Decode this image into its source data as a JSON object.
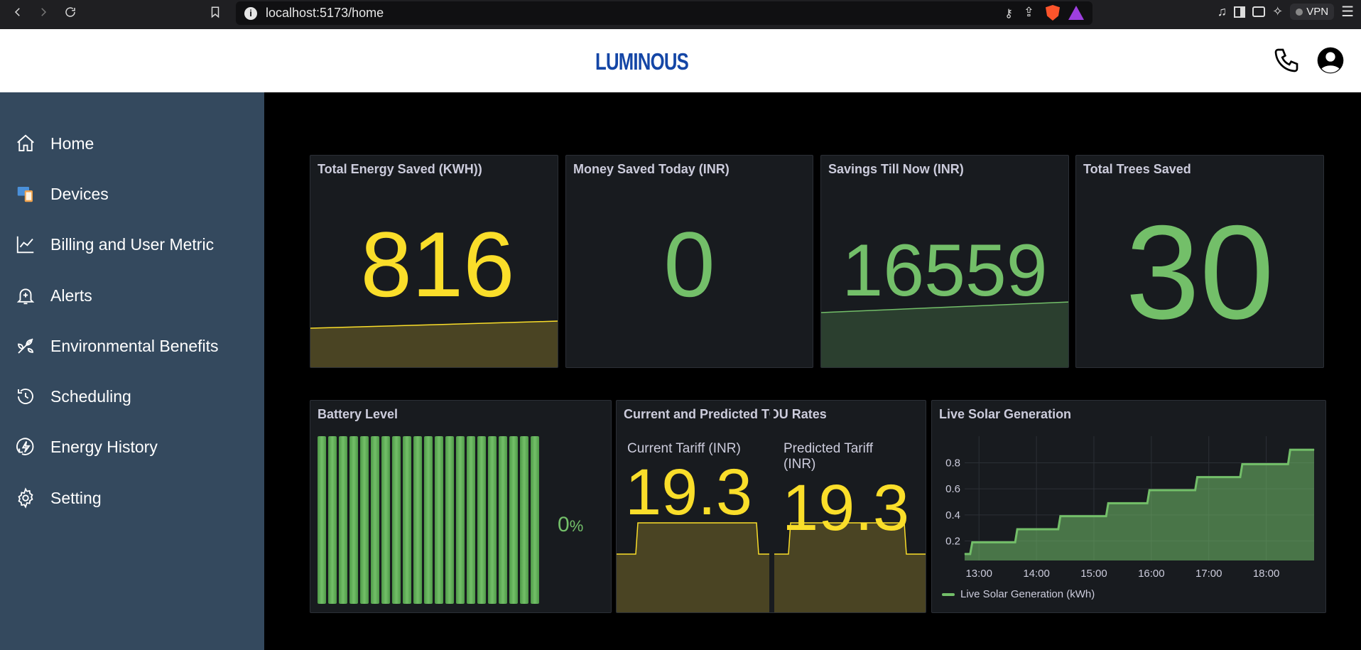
{
  "browser": {
    "url": "localhost:5173/home",
    "vpn_label": "VPN"
  },
  "header": {
    "logo_text": "LUMINOUS"
  },
  "sidebar": {
    "items": [
      {
        "label": "Home",
        "icon": "home-icon"
      },
      {
        "label": "Devices",
        "icon": "devices-icon"
      },
      {
        "label": "Billing and User Metric",
        "icon": "chart-line-icon"
      },
      {
        "label": "Alerts",
        "icon": "bell-icon"
      },
      {
        "label": "Environmental Benefits",
        "icon": "leaf-icon"
      },
      {
        "label": "Scheduling",
        "icon": "history-icon"
      },
      {
        "label": "Energy History",
        "icon": "energy-icon"
      },
      {
        "label": "Setting",
        "icon": "gear-icon"
      }
    ]
  },
  "stats": {
    "energy": {
      "title": "Total Energy Saved (KWH))",
      "value": "816"
    },
    "money": {
      "title": "Money Saved Today (INR)",
      "value": "0"
    },
    "savings": {
      "title": "Savings Till Now (INR)",
      "value": "16559"
    },
    "trees": {
      "title": "Total Trees Saved",
      "value": "30"
    }
  },
  "battery": {
    "title": "Battery Level",
    "percent_value": "0",
    "percent_unit": "%",
    "cell_count": 21
  },
  "tou": {
    "title": "Current and Predicted TOU Rates",
    "current_label": "Current Tariff (INR)",
    "current_value": "19.3",
    "predicted_label": "Predicted Tariff (INR)",
    "predicted_value": "19.3"
  },
  "colors": {
    "accent_yellow": "#fade2a",
    "accent_green": "#73bf69",
    "sidebar_bg": "#34495e",
    "panel_bg": "#181b1f",
    "logo_blue": "#1446a6"
  },
  "chart_data": {
    "type": "area",
    "title": "Live Solar Generation",
    "xlabel": "",
    "ylabel": "",
    "x_ticks": [
      "13:00",
      "14:00",
      "15:00",
      "16:00",
      "17:00",
      "18:00"
    ],
    "y_ticks": [
      0.2,
      0.4,
      0.6,
      0.8
    ],
    "xlim": [
      "12:45",
      "18:50"
    ],
    "ylim": [
      0.05,
      0.95
    ],
    "grid": true,
    "legend_placement": "bottom-left",
    "series": [
      {
        "name": "Live Solar Generation (kWh)",
        "color": "#73bf69",
        "step": true,
        "x": [
          "12:45",
          "12:53",
          "13:40",
          "14:25",
          "15:15",
          "15:58",
          "16:48",
          "17:35",
          "18:25",
          "18:50"
        ],
        "values": [
          0.1,
          0.19,
          0.29,
          0.39,
          0.49,
          0.59,
          0.69,
          0.79,
          0.9,
          0.9
        ]
      }
    ]
  }
}
